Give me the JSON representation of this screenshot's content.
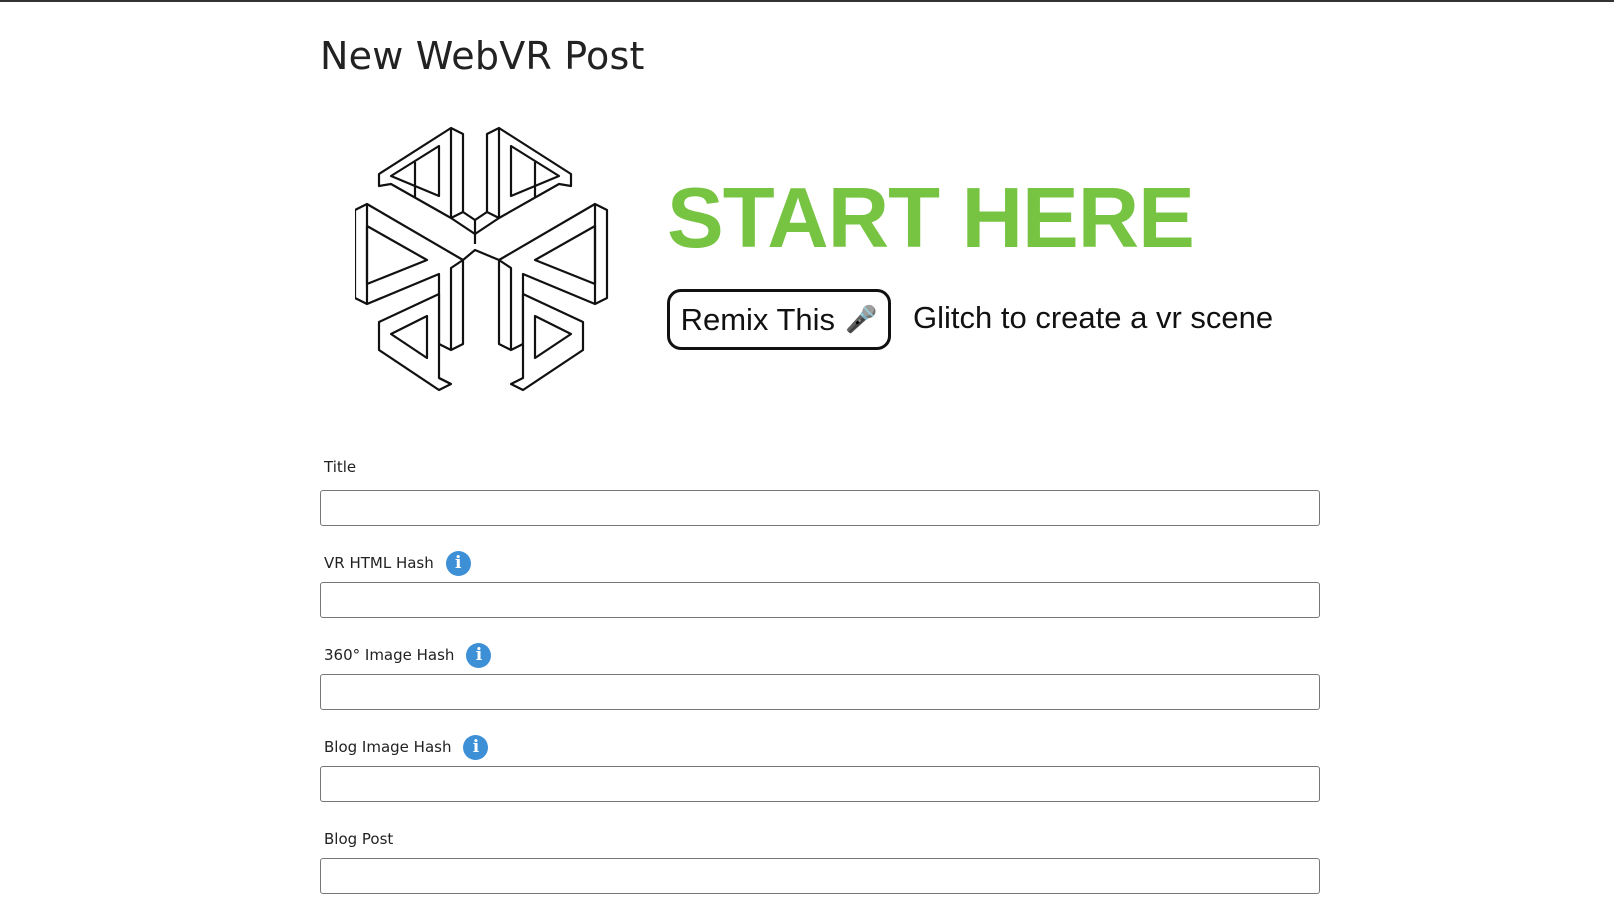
{
  "page": {
    "title": "New WebVR Post"
  },
  "banner": {
    "logo_icon": "impossible-cube-logo-icon",
    "headline": "START HERE",
    "headline_color": "#76c442",
    "remix_button_label": "Remix This",
    "remix_button_icon": "microphone-icon",
    "remix_button_glyph": "🎤",
    "tagline": "Glitch to create a vr scene"
  },
  "form": {
    "fields": [
      {
        "label": "Title",
        "value": "",
        "has_info": false
      },
      {
        "label": "VR HTML Hash",
        "value": "",
        "has_info": true
      },
      {
        "label": "360° Image Hash",
        "value": "",
        "has_info": true
      },
      {
        "label": "Blog Image Hash",
        "value": "",
        "has_info": true
      },
      {
        "label": "Blog Post",
        "value": "",
        "has_info": false
      }
    ],
    "info_glyph": "i",
    "info_color": "#3d8fd6"
  }
}
